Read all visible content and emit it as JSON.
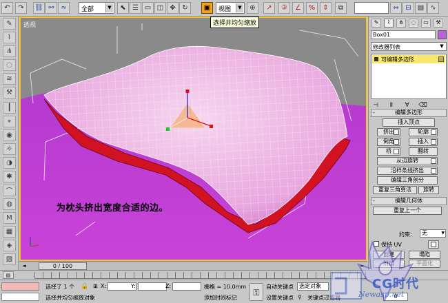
{
  "toolbar": {
    "selection_filter": "全部",
    "ref_coord": "视图",
    "tooltip": "选择并均匀缩放"
  },
  "viewport": {
    "label": "透视",
    "annotation": "为枕头挤出宽度合适的边。"
  },
  "command_panel": {
    "object_name": "Box01",
    "modifier_list": "修改器列表",
    "stack_item": "可编辑多边形",
    "rollout_edit_poly": "编辑多边形",
    "buttons_edit_poly": {
      "insert_vertex": "插入顶点",
      "extrude": "挤出",
      "outline": "轮廓",
      "bevel": "倒角",
      "inset": "插入",
      "bridge": "桥",
      "flip": "翻转",
      "hinge_from_edge": "从边旋转",
      "extrude_along_spline": "沿样条线挤出",
      "edit_triangulation": "编辑三角剖分",
      "retriangulate": "重复三角算法",
      "turn": "旋转"
    },
    "rollout_edit_geom": "编辑几何体",
    "repeat_last": "重复上一个",
    "constraints_label": "约束:",
    "constraints_value": "无",
    "preserve_uv": "保持 UV",
    "create": "创建",
    "collapse": "塌陷",
    "attach": "附加",
    "panel_bottom": "平面化"
  },
  "time_slider": {
    "frame": "0 / 100"
  },
  "status": {
    "selected": "选择了 1 个",
    "hint": "选择并均匀缩放对象",
    "x_label": "X:",
    "y_label": "Y:",
    "z_label": "Z:",
    "grid": "栅格 = 10.0mm",
    "add_time_tag": "添加时间标记",
    "auto_key": "自动关键点",
    "set_key": "设置关键点",
    "selection_set": "选定对象",
    "key_filters": "关键点过滤器",
    "frame_value": "0"
  },
  "watermark": {
    "brand": "CG时代",
    "url": "Newasp.net"
  },
  "colors": {
    "viewport_bg": "#8a8a8a",
    "ground": "#c63fd6",
    "pillow": "#f1c4ea",
    "pillow_rim": "#d8101e",
    "active_border": "#f4c42c",
    "gizmo": "#f5a050"
  }
}
